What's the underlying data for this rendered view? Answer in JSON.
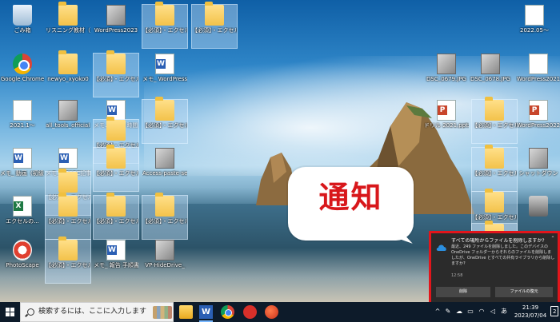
{
  "desktop": {
    "icons": [
      {
        "label": "ごみ箱",
        "kind": "recycle-bin-icon"
      },
      {
        "label": "リスニング教材（東",
        "kind": "folder-icon"
      },
      {
        "label": "WordPress2023",
        "kind": "thumbnail-icon"
      },
      {
        "label": "【必須】・エクセル 作",
        "kind": "folder-icon"
      },
      {
        "label": "【必須】・エクセル 作",
        "kind": "folder-icon"
      },
      {
        "label": "Google Chrome",
        "kind": "chrome-icon"
      },
      {
        "label": "newyo_xyoko0",
        "kind": "folder-icon"
      },
      {
        "label": "【必須】・エクセル 作",
        "kind": "folder-icon"
      },
      {
        "label": "メモ_ WordPress2021",
        "kind": "word-icon"
      },
      {
        "label": "2021.1～",
        "kind": "doc-icon"
      },
      {
        "label": "all_tools_official_",
        "kind": "zip-icon"
      },
      {
        "label": "メモ、1日 3 時間 docx",
        "kind": "word-icon"
      },
      {
        "label": "【必須】・エクセル 作",
        "kind": "folder-icon"
      },
      {
        "label": "【必須】・エクセル 作",
        "kind": "folder-icon"
      },
      {
        "label": "メモ_ 動画（初級 作）.docx",
        "kind": "word-icon"
      },
      {
        "label": "メモ_ TOSEC記事.docx",
        "kind": "word-icon"
      },
      {
        "label": "【必須】・エクセル 作",
        "kind": "folder-icon"
      },
      {
        "label": "【必須】・エクセル 作",
        "kind": "folder-icon"
      },
      {
        "label": "Access-paste-sent...",
        "kind": "thumbnail-icon"
      },
      {
        "label": "エクセルの...",
        "kind": "excel-icon"
      },
      {
        "label": "【必須】・エクセル 作",
        "kind": "folder-icon"
      },
      {
        "label": "【必須】・エクセル 作",
        "kind": "folder-icon"
      },
      {
        "label": "【必須】・エクセル 作",
        "kind": "folder-icon"
      },
      {
        "label": "PhotoScape",
        "kind": "photoscape-icon"
      },
      {
        "label": "【必須】・エクセル 作",
        "kind": "folder-icon"
      },
      {
        "label": "メモ_ 報告 手順書.docx",
        "kind": "word-icon"
      },
      {
        "label": "VP-HideDrive_",
        "kind": "thumbnail-icon"
      },
      {
        "label": "2022.05～",
        "kind": "doc-icon"
      },
      {
        "label": "DSC_0679.JPG",
        "kind": "thumbnail-icon"
      },
      {
        "label": "DSC_0678.JPG",
        "kind": "thumbnail-icon"
      },
      {
        "label": "WordPress2021",
        "kind": "doc-icon"
      },
      {
        "label": "ドリル 2021.pptx",
        "kind": "ppt-icon"
      },
      {
        "label": "【必須】・エクセル 作",
        "kind": "folder-icon"
      },
      {
        "label": "WordPress2022",
        "kind": "ppt-icon"
      },
      {
        "label": "【必須】・エクセル 作",
        "kind": "folder-icon"
      },
      {
        "label": "シャットダウン",
        "kind": "thumbnail-icon"
      },
      {
        "label": "【必須】・エクセル 作",
        "kind": "folder-icon"
      },
      {
        "label": "【必須】・エクセル 作",
        "kind": "folder-icon"
      },
      {
        "label": "",
        "kind": "gear-icon"
      }
    ]
  },
  "callout": {
    "text": "通知"
  },
  "toast": {
    "title": "すべての場所からファイルを削除しますか?",
    "body": "最近、249 ファイルを削除しました。このデバイスの OneDrive フォルダーからそれらのファイルを削除しましたが、OneDrive とすべての共有ライブラリから削除しますか?",
    "time": "12:58",
    "delete_label": "削除",
    "restore_label": "ファイルの復元",
    "frame_color": "#e2151b"
  },
  "taskbar": {
    "search_placeholder": "検索するには、ここに入力します",
    "time": "21:39",
    "date": "2023/07/04",
    "ime": "あ",
    "notification_count": "2"
  },
  "colors": {
    "taskbar_bg": "#0d1b2a",
    "accent": "#d8171b"
  }
}
